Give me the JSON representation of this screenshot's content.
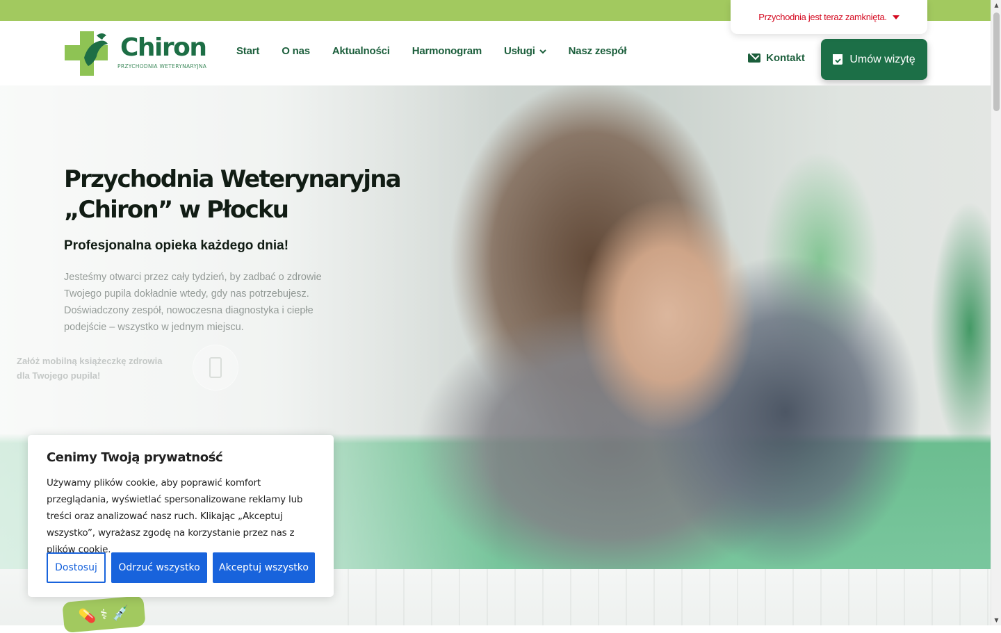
{
  "header": {
    "logo_text": "Chiron",
    "logo_subtitle": "PRZYCHODNIA WETERYNARYJNA",
    "nav": [
      {
        "label": "Start"
      },
      {
        "label": "O nas"
      },
      {
        "label": "Aktualności"
      },
      {
        "label": "Harmonogram"
      },
      {
        "label": "Usługi",
        "has_dropdown": true
      },
      {
        "label": "Nasz zespół"
      }
    ],
    "status": "Przychodnia jest teraz zamknięta.",
    "contact_label": "Kontakt",
    "cta_label": "Umów wizytę"
  },
  "hero": {
    "title_line1": "Przychodnia Weterynaryjna",
    "title_line2": "„Chiron” w Płocku",
    "subtitle": "Profesjonalna opieka każdego dnia!",
    "description": "Jesteśmy otwarci przez cały tydzień, by zadbać o zdrowie Twojego pupila dokładnie wtedy, gdy nas potrzebujesz. Doświadczony zespół, nowoczesna diagnostyka i ciepłe podejście – wszystko w jednym miejscu.",
    "app_promo_line1": "Załóż mobilną książeczkę zdrowia",
    "app_promo_line2": "dla Twojego pupila!"
  },
  "cookie": {
    "title": "Cenimy Twoją prywatność",
    "text": "Używamy plików cookie, aby poprawić komfort przeglądania, wyświetlać spersonalizowane reklamy lub treści oraz analizować nasz ruch. Klikając „Akceptuj wszystko”, wyrażasz zgodę na korzystanie przez nas z plików cookie.",
    "customize": "Dostosuj",
    "reject": "Odrzuć wszystko",
    "accept": "Akceptuj wszystko"
  },
  "colors": {
    "brand_green": "#1c6f47",
    "top_bar": "#a2c95f",
    "status_red": "#d4081f",
    "cookie_blue": "#1863dc"
  },
  "icons": [
    "envelope-icon",
    "calendar-check-icon",
    "chevron-down-icon",
    "phone-icon",
    "medical-icons-badge"
  ]
}
